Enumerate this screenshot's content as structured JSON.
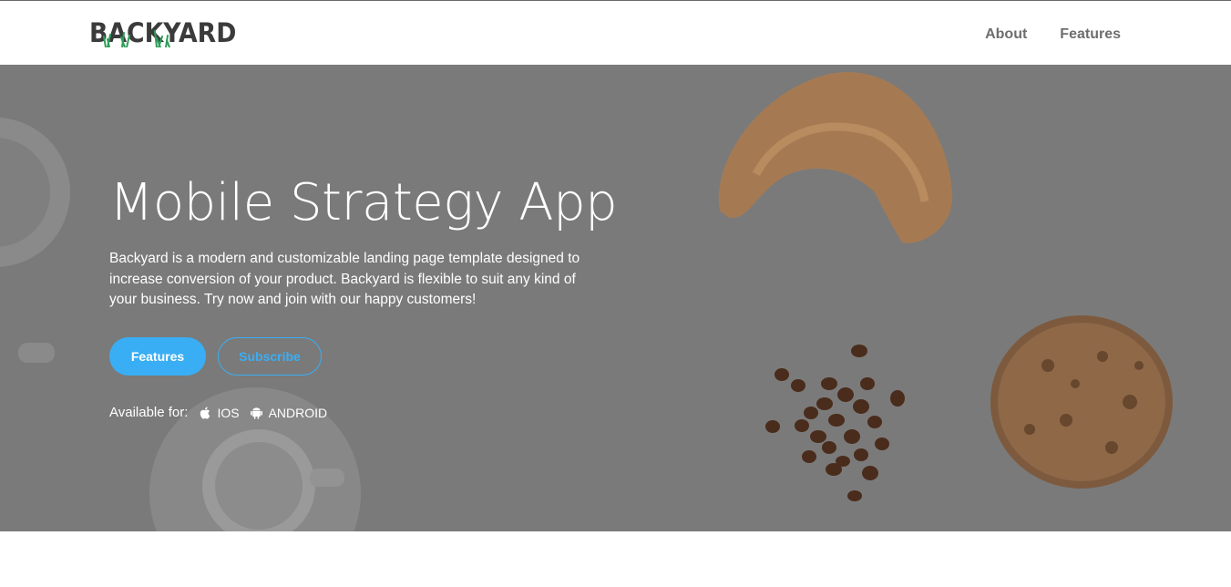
{
  "header": {
    "logo_text": "BACKYARD",
    "nav": [
      {
        "label": "About"
      },
      {
        "label": "Features"
      }
    ]
  },
  "hero": {
    "title": "Mobile Strategy App",
    "description": "Backyard is a modern and customizable landing page template designed to increase conversion of your product. Backyard is flexible to suit any kind of your business. Try now and join with our happy customers!",
    "primary_button": "Features",
    "secondary_button": "Subscribe",
    "available_label": "Available for:",
    "platforms": [
      {
        "icon": "apple-icon",
        "label": "IOS"
      },
      {
        "icon": "android-icon",
        "label": "ANDROID"
      }
    ]
  },
  "colors": {
    "accent": "#3aaef4",
    "hero_overlay": "#7a7a7a",
    "logo": "#3b3b3b",
    "grass": "#2e9e5a"
  }
}
